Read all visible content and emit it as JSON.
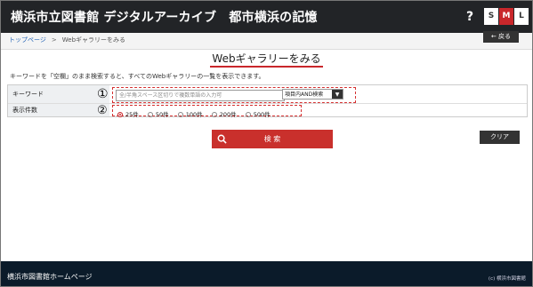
{
  "header": {
    "title": "横浜市立図書館 デジタルアーカイブ　都市横浜の記憶",
    "help": "?",
    "font_sizes": [
      "S",
      "M",
      "L"
    ]
  },
  "breadcrumb": {
    "home": "トップページ",
    "sep": ">",
    "current": "Webギャラリーをみる"
  },
  "back_button": {
    "arrow": "←",
    "label": "戻る"
  },
  "page_title": "Webギャラリーをみる",
  "intro": "キーワードを「空欄」のまま検索すると、すべてのWebギャラリーの一覧を表示できます。",
  "form": {
    "keyword_label": "キーワード",
    "keyword_marker": "①",
    "keyword_placeholder": "全/半角スペース区切りで複数単語の入力可",
    "search_mode": "項目内AND検索",
    "count_label": "表示件数",
    "count_marker": "②",
    "count_options": [
      "25件",
      "50件",
      "100件",
      "200件",
      "500件"
    ],
    "count_selected": "25件"
  },
  "buttons": {
    "search": "検 索",
    "clear": "クリア"
  },
  "footer": {
    "link": "横浜市図書館ホームページ",
    "copyright": "(c) 横浜市図書館"
  },
  "colors": {
    "header_bg": "#222427",
    "accent": "#c9272b",
    "footer_bg": "#0b1b2a"
  }
}
